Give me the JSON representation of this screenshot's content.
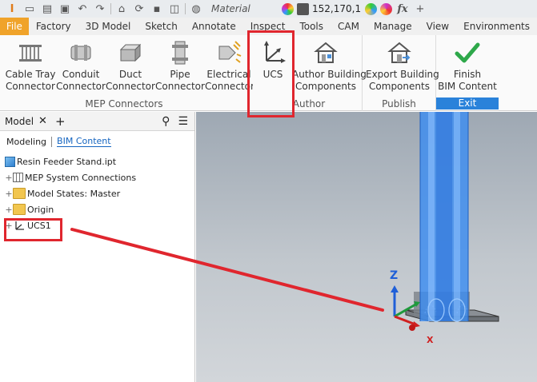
{
  "quick_access": {
    "material_label": "Material",
    "color_value": "152,170,175",
    "fx_label": "fx"
  },
  "tabs": [
    {
      "label": "File"
    },
    {
      "label": "Factory"
    },
    {
      "label": "3D Model"
    },
    {
      "label": "Sketch"
    },
    {
      "label": "Annotate"
    },
    {
      "label": "Inspect"
    },
    {
      "label": "Tools"
    },
    {
      "label": "CAM"
    },
    {
      "label": "Manage"
    },
    {
      "label": "View"
    },
    {
      "label": "Environments"
    }
  ],
  "ribbon": {
    "mep": {
      "title": "MEP Connectors",
      "buttons": [
        {
          "line1": "Cable Tray",
          "line2": "Connector"
        },
        {
          "line1": "Conduit",
          "line2": "Connector"
        },
        {
          "line1": "Duct",
          "line2": "Connector"
        },
        {
          "line1": "Pipe",
          "line2": "Connector"
        },
        {
          "line1": "Electrical",
          "line2": "Connector"
        }
      ]
    },
    "author": {
      "title": "Author",
      "ucs_label": "UCS",
      "components_line1": "Author Building",
      "components_line2": "Components"
    },
    "publish": {
      "title": "Publish",
      "line1": "Export Building",
      "line2": "Components"
    },
    "exit": {
      "title": "Exit",
      "line1": "Finish",
      "line2": "BIM Content"
    }
  },
  "browser": {
    "tab_label": "Model",
    "subtabs": [
      "Modeling",
      "BIM Content"
    ],
    "tree": [
      {
        "label": "Resin Feeder Stand.ipt",
        "icon": "part-icon"
      },
      {
        "label": "MEP System Connections",
        "icon": "mep-connections-icon"
      },
      {
        "label": "Model States: Master",
        "icon": "folder-icon"
      },
      {
        "label": "Origin",
        "icon": "folder-icon"
      },
      {
        "label": "UCS1",
        "icon": "ucs-icon"
      }
    ]
  },
  "viewport": {
    "axis_z": "Z",
    "axis_x": "X"
  },
  "colors": {
    "file_tab": "#f0a32a",
    "exit_bar": "#2a82da",
    "annotation_red": "#e0262e",
    "model_blue": "#3c8cf0"
  }
}
